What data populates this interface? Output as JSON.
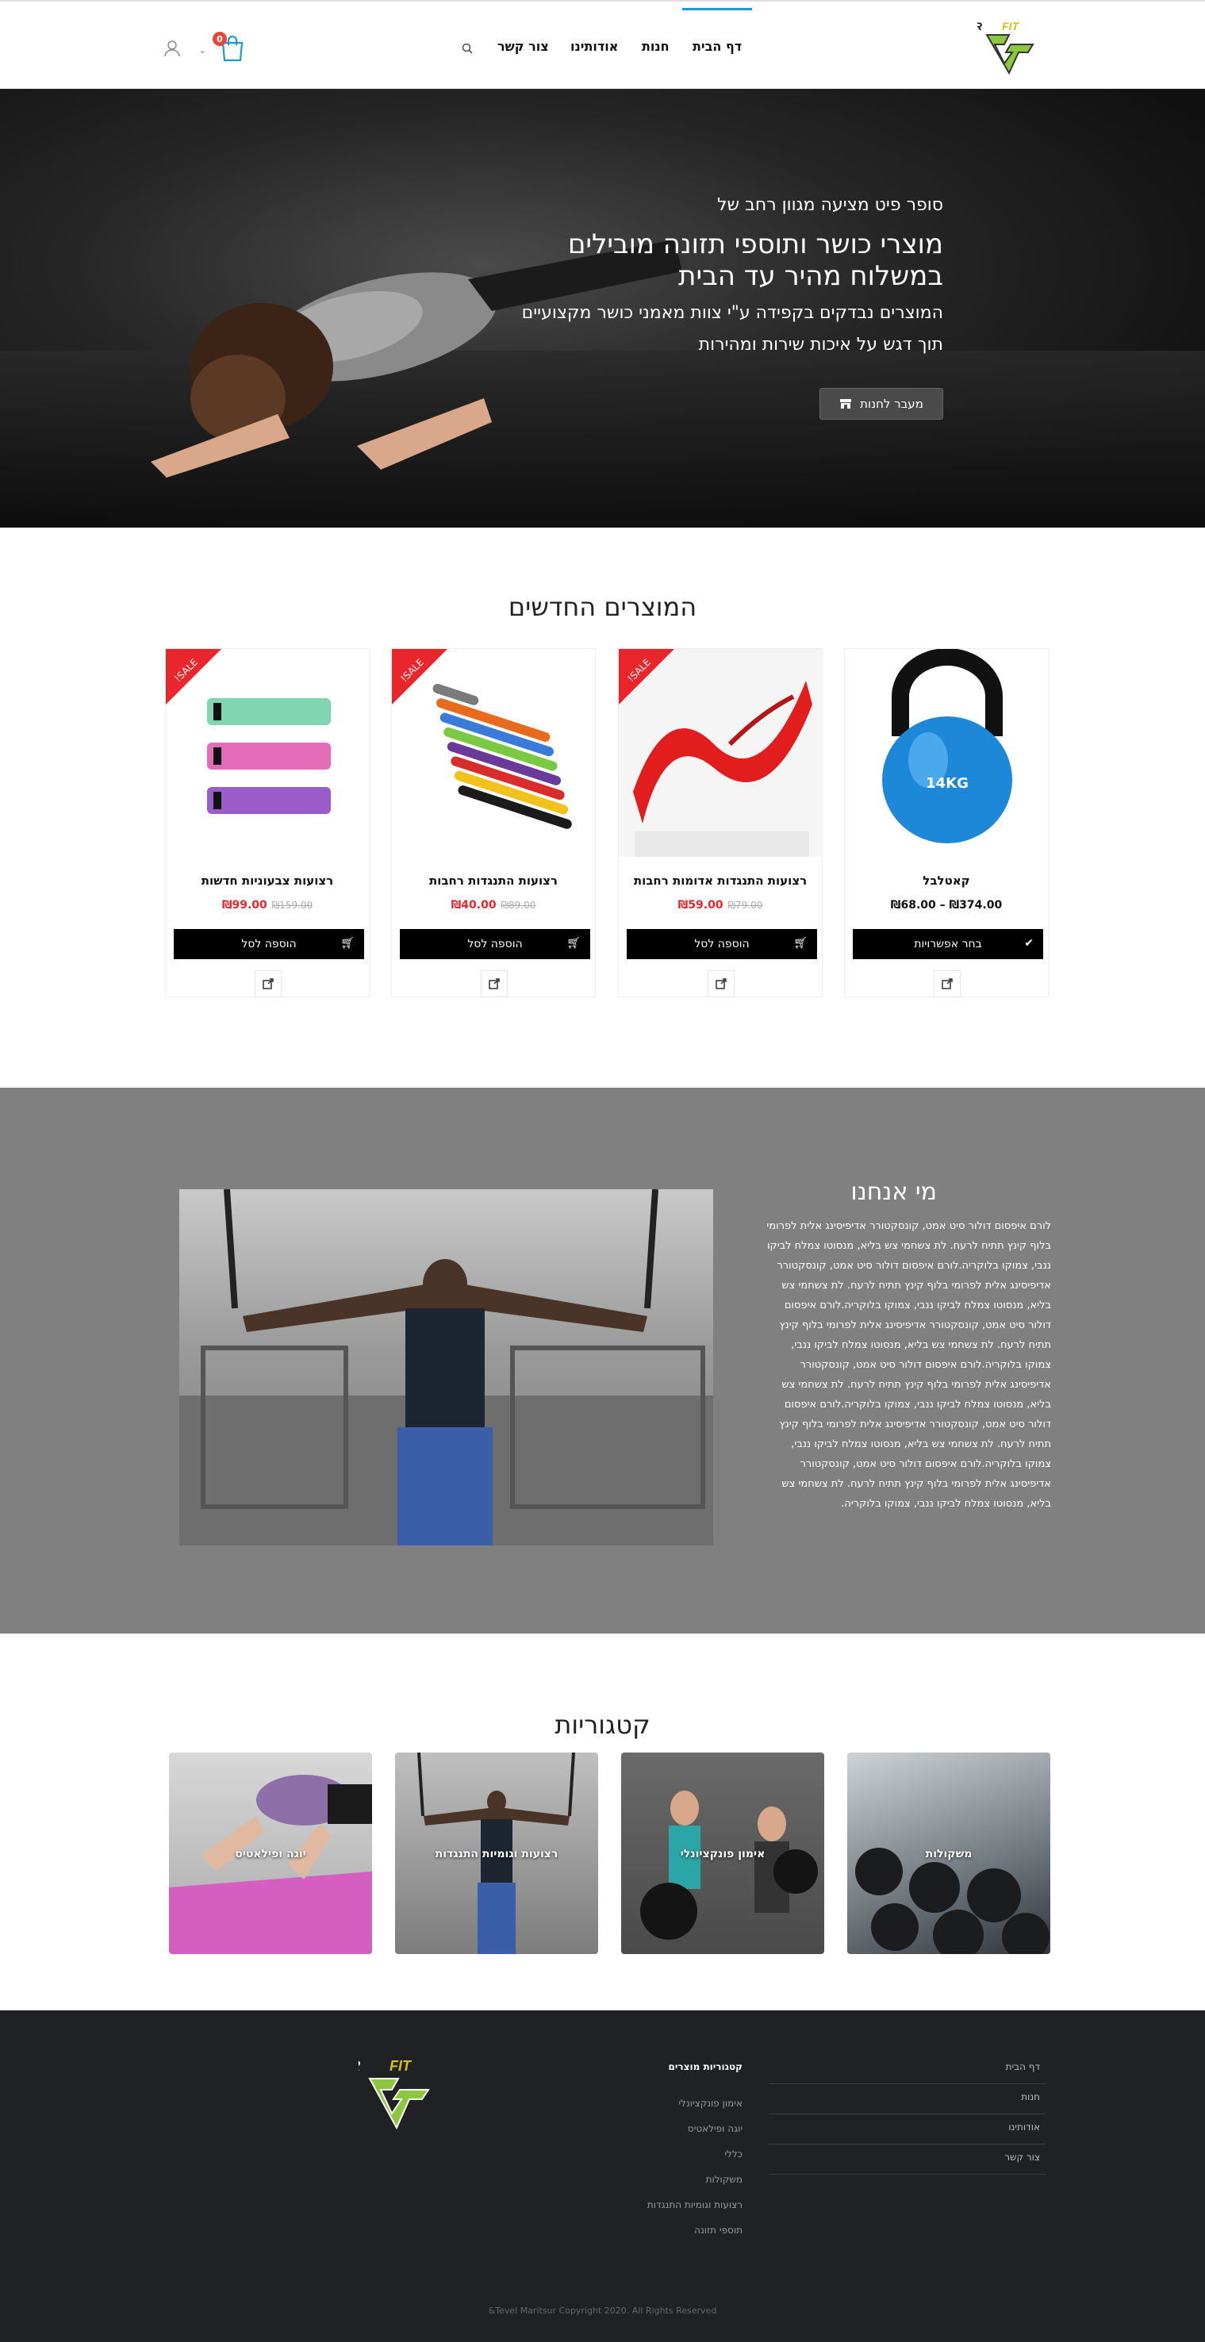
{
  "header": {
    "logo_text": "SUPER FIT",
    "nav": [
      {
        "label": "דף הבית",
        "active": true
      },
      {
        "label": "חנות",
        "active": false
      },
      {
        "label": "אודותינו",
        "active": false
      },
      {
        "label": "צור קשר",
        "active": false
      }
    ],
    "cart_count": "0",
    "accent_color": "#1a9ad6"
  },
  "hero": {
    "subtitle": "סופר פיט מציעה מגוון רחב של",
    "title_line1": "מוצרי כושר ותוספי תזונה מובילים",
    "title_line2": "במשלוח מהיר עד הבית",
    "line1": "המוצרים נבדקים בקפידה ע\"י צוות מאמני כושר מקצועיים",
    "line2": "תוך דגש על איכות שירות ומהירות",
    "button_label": "מעבר לחנות"
  },
  "products_section": {
    "title": "המוצרים החדשים",
    "sale_label": "SALE!",
    "products": [
      {
        "name": "קאטלבל",
        "price": "₪374.00 – ₪68.00",
        "on_sale": false,
        "button": "בחר אפשרויות",
        "image_label": "14KG"
      },
      {
        "name": "רצועות התנגדות אדומות רחבות",
        "price": "₪59.00",
        "old_price": "₪79.00",
        "on_sale": true,
        "button": "הוספה לסל"
      },
      {
        "name": "רצועות התנגדות רחבות",
        "price": "₪40.00",
        "old_price": "₪89.00",
        "on_sale": true,
        "button": "הוספה לסל"
      },
      {
        "name": "רצועות צבעוניות חדשות",
        "price": "₪99.00",
        "old_price": "₪159.00",
        "on_sale": true,
        "button": "הוספה לסל"
      }
    ]
  },
  "about": {
    "title": "מי אנחנו",
    "text": "לורם איפסום דולור סיט אמט, קונסקטורר אדיפיסינג אלית לפרומי בלוף קינץ תתיח לרעח. לת צשחמי צש בליא, מנסוטו צמלח לביקו ננבי, צמוקו בלוקריה.לורם איפסום דולור סיט אמט, קונסקטורר אדיפיסינג אלית לפרומי בלוף קינץ תתיח לרעח. לת צשחמי צש בליא, מנסוטו צמלח לביקו ננבי, צמוקו בלוקריה.לורם איפסום דולור סיט אמט, קונסקטורר אדיפיסינג אלית לפרומי בלוף קינץ תתיח לרעח. לת צשחמי צש בליא, מנסוטו צמלח לביקו ננבי, צמוקו בלוקריה.לורם איפסום דולור סיט אמט, קונסקטורר אדיפיסינג אלית לפרומי בלוף קינץ תתיח לרעח. לת צשחמי צש בליא, מנסוטו צמלח לביקו ננבי, צמוקו בלוקריה.לורם איפסום דולור סיט אמט, קונסקטורר אדיפיסינג אלית לפרומי בלוף קינץ תתיח לרעח. לת צשחמי צש בליא, מנסוטו צמלח לביקו ננבי, צמוקו בלוקריה.לורם איפסום דולור סיט אמט, קונסקטורר אדיפיסינג אלית לפרומי בלוף קינץ תתיח לרעח. לת צשחמי צש בליא, מנסוטו צמלח לביקו ננבי, צמוקו בלוקריה."
  },
  "categories": {
    "title": "קטגוריות",
    "items": [
      {
        "label": "משקולות"
      },
      {
        "label": "אימון פונקציונלי"
      },
      {
        "label": "רצועות וגומיות התנגדות"
      },
      {
        "label": "יוגה ופילאטיס"
      }
    ]
  },
  "footer": {
    "menu": [
      "דף הבית",
      "חנות",
      "אודותינו",
      "צור קשר"
    ],
    "cat_title": "קטגוריות מוצרים",
    "cats": [
      "אימון פונקציונלי",
      "יוגה ופילאטיס",
      "כללי",
      "משקולות",
      "רצועות וגומיות התנגדות",
      "תוספי תזונה"
    ],
    "copyright": "Tevel Maritsur Copyright 2020. All Rights Reserved&"
  }
}
